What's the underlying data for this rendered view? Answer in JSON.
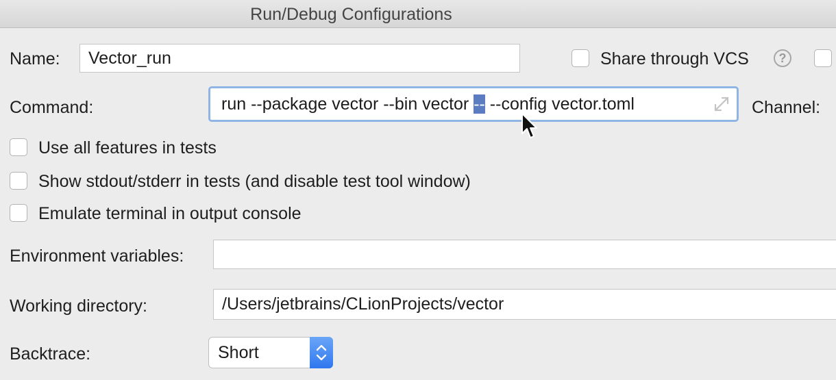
{
  "window": {
    "title": "Run/Debug Configurations"
  },
  "name_row": {
    "label": "Name:",
    "value": "Vector_run",
    "share_label": "Share through VCS",
    "help_glyph": "?"
  },
  "command": {
    "label": "Command:",
    "text_before": "run --package vector --bin vector ",
    "selected": "--",
    "text_after": " --config vector.toml",
    "channel_label": "Channel:"
  },
  "options": [
    {
      "label": "Use all features in tests",
      "checked": false
    },
    {
      "label": "Show stdout/stderr in tests (and disable test tool window)",
      "checked": false
    },
    {
      "label": "Emulate terminal in output console",
      "checked": false
    }
  ],
  "env": {
    "label": "Environment variables:",
    "value": ""
  },
  "workdir": {
    "label": "Working directory:",
    "value": "/Users/jetbrains/CLionProjects/vector"
  },
  "backtrace": {
    "label": "Backtrace:",
    "value": "Short"
  },
  "icons": {
    "help": "question-circle-icon",
    "expand": "expand-diagonal-icon",
    "cursor": "mouse-pointer-icon",
    "stepper": "up-down-chevron-icon"
  },
  "colors": {
    "accent": "#2f77ef",
    "focus_ring": "#8fb4e6",
    "selection": "#5b7cc0",
    "background": "#ececec"
  }
}
